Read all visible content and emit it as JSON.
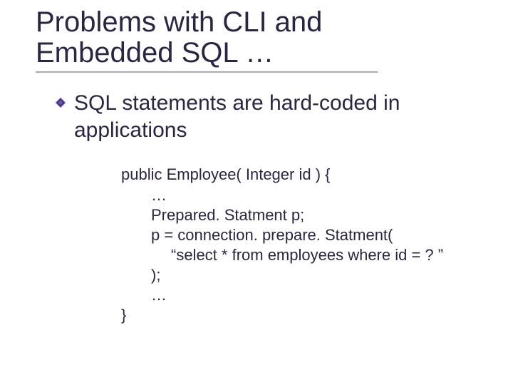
{
  "title": {
    "line1": "Problems with CLI and",
    "line2": "Embedded SQL …"
  },
  "bullet": {
    "text": "SQL statements are hard-coded in applications"
  },
  "code": {
    "l1": "public Employee( Integer id ) {",
    "l2": "…",
    "l3": "Prepared. Statment p;",
    "l4": "p = connection. prepare. Statment(",
    "l5": "“select * from employees where id = ? ”",
    "l6": ");",
    "l7": "…",
    "l8": "}"
  },
  "icons": {
    "bullet": "diamond-bullet-icon"
  }
}
